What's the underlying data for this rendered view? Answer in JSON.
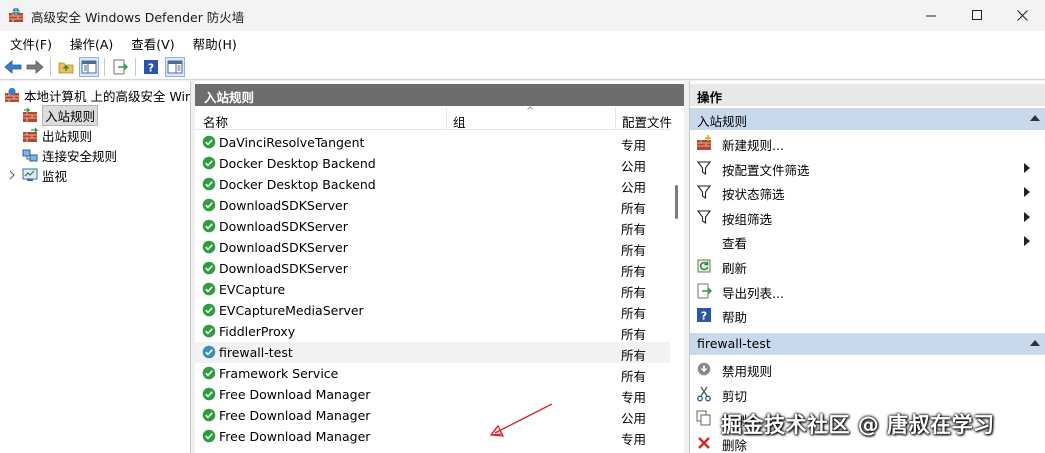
{
  "window": {
    "title": "高级安全 Windows Defender 防火墙"
  },
  "menu": [
    "文件(F)",
    "操作(A)",
    "查看(V)",
    "帮助(H)"
  ],
  "tree": {
    "root": "本地计算机 上的高级安全 Windows Defender 防火墙",
    "items": [
      "入站规则",
      "出站规则",
      "连接安全规则",
      "监视"
    ]
  },
  "center": {
    "title": "入站规则",
    "columns": [
      "名称",
      "组",
      "配置文件"
    ],
    "rows": [
      {
        "name": "DaVinciResolveTangent",
        "profile": "专用"
      },
      {
        "name": "Docker Desktop Backend",
        "profile": "公用"
      },
      {
        "name": "Docker Desktop Backend",
        "profile": "公用"
      },
      {
        "name": "DownloadSDKServer",
        "profile": "所有"
      },
      {
        "name": "DownloadSDKServer",
        "profile": "所有"
      },
      {
        "name": "DownloadSDKServer",
        "profile": "所有"
      },
      {
        "name": "DownloadSDKServer",
        "profile": "所有"
      },
      {
        "name": "EVCapture",
        "profile": "所有"
      },
      {
        "name": "EVCaptureMediaServer",
        "profile": "所有"
      },
      {
        "name": "FiddlerProxy",
        "profile": "所有"
      },
      {
        "name": "firewall-test",
        "profile": "所有"
      },
      {
        "name": "Framework Service",
        "profile": "所有"
      },
      {
        "name": "Free Download Manager",
        "profile": "专用"
      },
      {
        "name": "Free Download Manager",
        "profile": "公用"
      },
      {
        "name": "Free Download Manager",
        "profile": "专用"
      }
    ]
  },
  "actions": {
    "title": "操作",
    "section1": {
      "title": "入站规则",
      "items": [
        {
          "label": "新建规则...",
          "icon": "new-rule-icon"
        },
        {
          "label": "按配置文件筛选",
          "icon": "filter-icon"
        },
        {
          "label": "按状态筛选",
          "icon": "filter-icon"
        },
        {
          "label": "按组筛选",
          "icon": "filter-icon"
        },
        {
          "label": "查看",
          "icon": ""
        },
        {
          "label": "刷新",
          "icon": "refresh-icon"
        },
        {
          "label": "导出列表...",
          "icon": "export-icon"
        },
        {
          "label": "帮助",
          "icon": "help-icon"
        }
      ]
    },
    "section2": {
      "title": "firewall-test",
      "items": [
        {
          "label": "禁用规则",
          "icon": "disable-icon"
        },
        {
          "label": "剪切",
          "icon": "cut-icon"
        },
        {
          "label": "复制",
          "icon": "copy-icon"
        },
        {
          "label": "删除",
          "icon": "delete-icon"
        }
      ]
    }
  },
  "watermark": "掘金技术社区 @ 唐叔在学习",
  "colors": {
    "header_dark": "#6d6d6d",
    "section_blue": "#c9d9ec",
    "rule_enabled_green": "#2e9e3e",
    "annotation_red": "#e0202a"
  }
}
